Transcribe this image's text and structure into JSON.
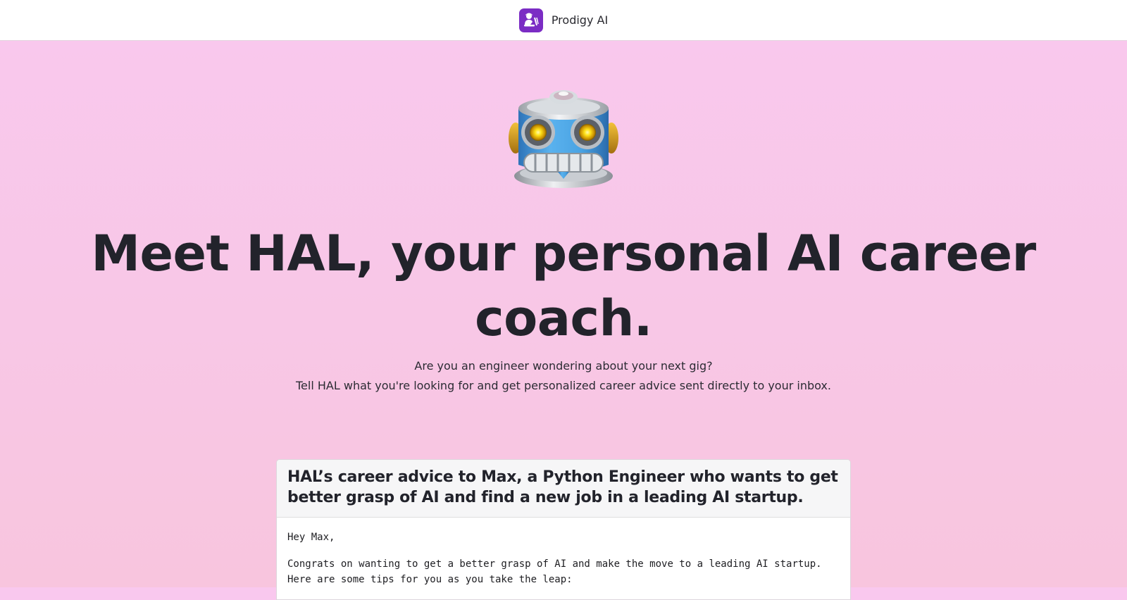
{
  "header": {
    "brand_name": "Prodigy AI",
    "logo_icon": "writer-at-desk-icon",
    "logo_color": "#7b2cc4"
  },
  "hero": {
    "mascot_icon": "robot-head-icon",
    "title": "Meet HAL, your personal AI career coach.",
    "subtitle_line1": "Are you an engineer wondering about your next gig?",
    "subtitle_line2": "Tell HAL what you're looking for and get personalized career advice sent directly to your inbox."
  },
  "example": {
    "title": "HAL’s career advice to Max, a Python Engineer who wants to get better grasp of AI and find a new job in a leading AI startup.",
    "greeting": "Hey Max,",
    "paragraph1": "Congrats on wanting to get a better grasp of AI and make the move to a leading AI startup.\nHere are some tips for you as you take the leap:"
  },
  "colors": {
    "background": "#f9c8ee",
    "text": "#22232b",
    "card_header": "#f6f6f7"
  }
}
